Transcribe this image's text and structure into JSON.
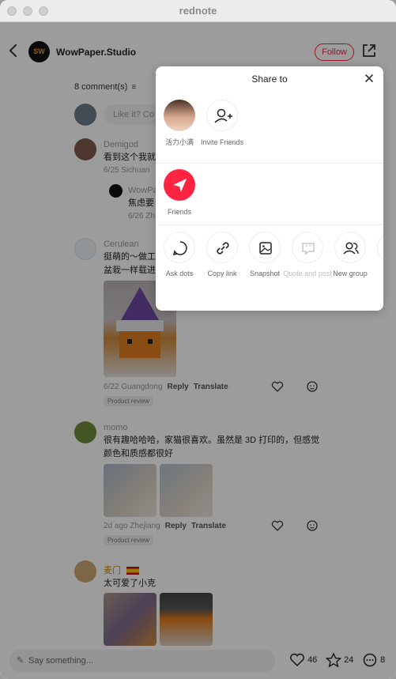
{
  "window": {
    "title": "rednote"
  },
  "header": {
    "username": "WowPaper.Studio",
    "logo_text": "SW",
    "follow_label": "Follow"
  },
  "comments": {
    "count_label": "8 comment(s)",
    "input_placeholder": "Like it? Co",
    "items": [
      {
        "name": "Demigod",
        "text": "看到这个我就",
        "meta": "6/25 Sichuan",
        "reply": {
          "name": "WowPap",
          "text": "焦虑要",
          "meta": "6/26 Zh"
        }
      },
      {
        "name": "Cerulean",
        "text": "挺萌的～做工",
        "text2": "盆栽一样载进",
        "meta": "6/22 Guangdong",
        "reply_label": "Reply",
        "translate_label": "Translate",
        "tag": "Product review"
      },
      {
        "name": "momo",
        "text": "很有趣哈哈哈，家猫很喜欢。虽然是 3D 打印的，但感觉",
        "text2": "颜色和质感都很好",
        "meta": "2d ago Zhejiang",
        "reply_label": "Reply",
        "translate_label": "Translate",
        "tag": "Product review"
      },
      {
        "name": "麦门",
        "text": "太可爱了小克"
      }
    ]
  },
  "bottom": {
    "placeholder": "Say something...",
    "likes": "46",
    "stars": "24",
    "comments": "8"
  },
  "share": {
    "title": "Share to",
    "contacts": [
      {
        "label": "活力小满"
      },
      {
        "label": "Invite Friends"
      }
    ],
    "friends_label": "Friends",
    "actions": [
      {
        "label": "Ask dots",
        "disabled": false
      },
      {
        "label": "Copy link",
        "disabled": false
      },
      {
        "label": "Snapshot",
        "disabled": false
      },
      {
        "label": "Quote and post",
        "disabled": true
      },
      {
        "label": "New group",
        "disabled": false
      }
    ]
  },
  "colors": {
    "accent": "#ff2442",
    "overlay": "rgba(0,0,0,0.39)"
  }
}
